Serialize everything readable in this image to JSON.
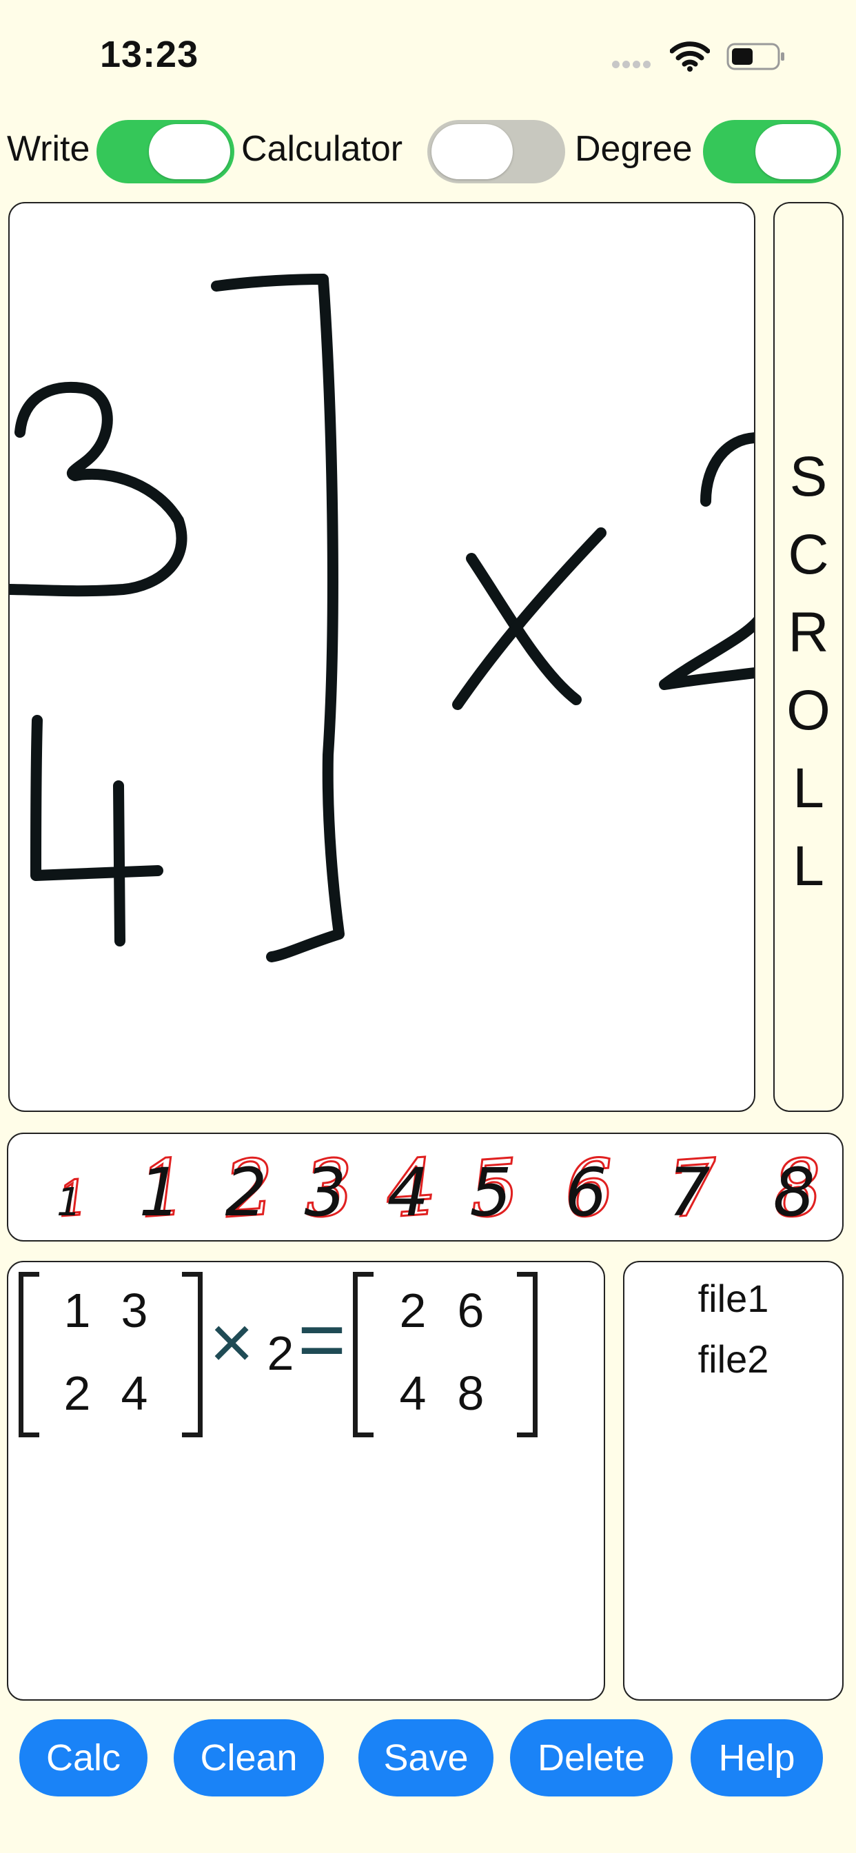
{
  "status_bar": {
    "time": "13:23"
  },
  "toggles": [
    {
      "label": "Write",
      "on": true
    },
    {
      "label": "Calculator",
      "on": false
    },
    {
      "label": "Degree",
      "on": true
    }
  ],
  "scroll_label": "SCROLL",
  "hint_digits": [
    "1",
    "1",
    "2",
    "3",
    "4",
    "5",
    "6",
    "7",
    "8"
  ],
  "result": {
    "left_matrix": [
      [
        "1",
        "3"
      ],
      [
        "2",
        "4"
      ]
    ],
    "operator": "×",
    "scalar": "2",
    "equals": "=",
    "right_matrix": [
      [
        "2",
        "6"
      ],
      [
        "4",
        "8"
      ]
    ]
  },
  "files": [
    "file1",
    "file2"
  ],
  "buttons": {
    "calc": "Calc",
    "clean": "Clean",
    "save": "Save",
    "delete": "Delete",
    "help": "Help"
  },
  "colors": {
    "background": "#fffde8",
    "switch_on": "#35c759",
    "switch_off": "#c8c8bf",
    "button": "#1a83f7",
    "stroke_hint": "#e02020",
    "result_operator": "#1f4b55"
  }
}
